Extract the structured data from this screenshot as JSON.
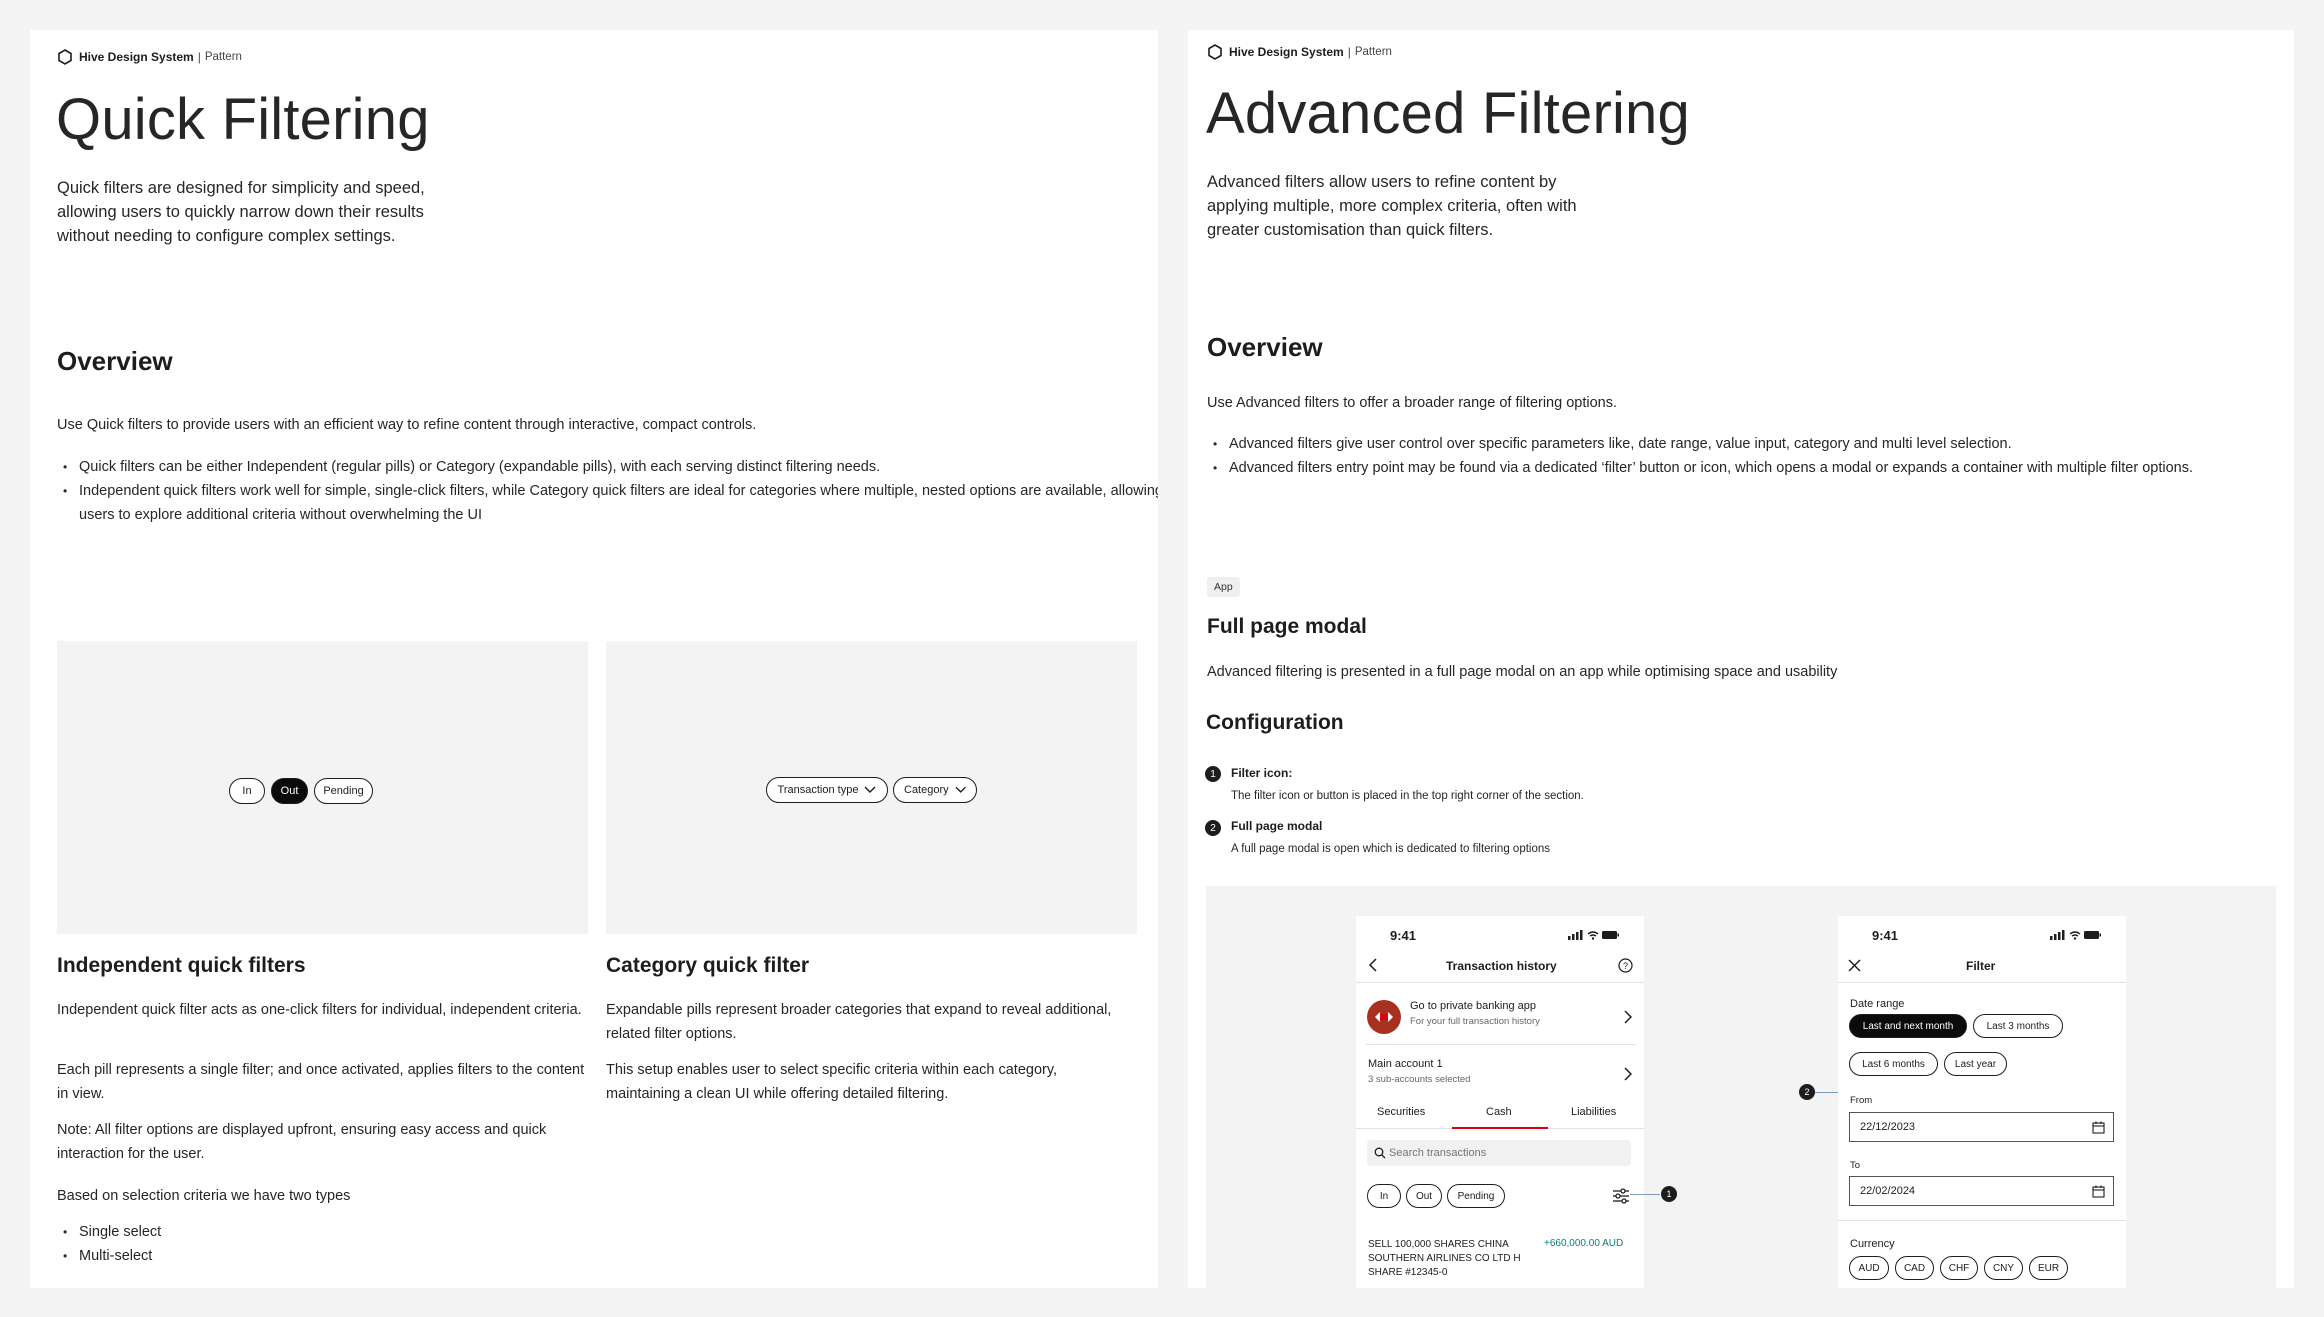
{
  "left": {
    "brand": {
      "name": "Hive Design System",
      "separator": "|",
      "type": "Pattern"
    },
    "title": "Quick Filtering",
    "intro": "Quick filters are designed for simplicity and speed, allowing users to quickly narrow down their results without needing to configure complex settings.",
    "overview_heading": "Overview",
    "overview_text": "Use Quick filters to provide users with an efficient way to refine content through interactive, compact controls.",
    "overview_bullets": [
      "Quick filters can be either Independent (regular pills) or Category (expandable pills), with each serving distinct filtering needs.",
      "Independent quick filters work well for simple, single-click filters, while Category quick filters are ideal for categories where multiple, nested options are available, allowing users to explore additional criteria without overwhelming the UI"
    ],
    "independent_pills": [
      "In",
      "Out",
      "Pending"
    ],
    "category_pills": [
      "Transaction type",
      "Category"
    ],
    "independent": {
      "heading": "Independent quick filters",
      "p1": "Independent quick filter acts as one-click filters for individual, independent criteria.",
      "p2": "Each pill represents a single filter; and once activated, applies filters to the content in view.",
      "p3": "Note: All filter options are displayed upfront, ensuring easy access and quick interaction for the user.",
      "p4": "Based on selection criteria we have two types",
      "types": [
        "Single select",
        "Multi-select"
      ]
    },
    "category": {
      "heading": "Category quick filter",
      "p1": "Expandable pills represent broader categories that expand to reveal additional, related filter options.",
      "p2": "This setup enables user to select specific criteria within each category, maintaining a clean UI while offering detailed filtering."
    }
  },
  "right": {
    "brand": {
      "name": "Hive Design System",
      "separator": "|",
      "type": "Pattern"
    },
    "title": "Advanced Filtering",
    "intro": "Advanced filters allow users to refine content by applying multiple, more complex criteria, often with greater customisation than quick filters.",
    "overview_heading": "Overview",
    "overview_text": "Use Advanced filters to offer a broader range of filtering options.",
    "overview_bullets": [
      "Advanced filters give user control over specific parameters like, date range, value input, category and multi level selection.",
      "Advanced filters entry point may be found via a dedicated ‘filter’ button or icon, which opens a modal or expands a container with multiple filter options."
    ],
    "tag": "App",
    "modal_heading": "Full page modal",
    "modal_text": "Advanced filtering is presented in a full page modal on an app while optimising space and usability",
    "config_heading": "Configuration",
    "steps": [
      {
        "num": "1",
        "title": "Filter icon:",
        "desc": "The filter icon or button is placed in the top right corner of the section."
      },
      {
        "num": "2",
        "title": "Full page modal",
        "desc": "A full page modal is open which is dedicated to filtering options"
      }
    ],
    "phone1": {
      "time": "9:41",
      "title": "Transaction history",
      "private_title": "Go to private banking app",
      "private_sub": "For your full transaction history",
      "account_title": "Main account 1",
      "account_sub": "3 sub-accounts selected",
      "tabs": [
        "Securities",
        "Cash",
        "Liabilities"
      ],
      "search_placeholder": "Search transactions",
      "pills": [
        "In",
        "Out",
        "Pending"
      ],
      "txn_desc": "SELL 100,000 SHARES CHINA SOUTHERN AIRLINES CO LTD H SHARE #12345-0",
      "txn_amount": "+660,000.00 AUD",
      "callout": "1"
    },
    "phone2": {
      "time": "9:41",
      "title": "Filter",
      "date_range_label": "Date range",
      "date_pills": [
        "Last and next month",
        "Last 3 months",
        "Last 6 months",
        "Last year"
      ],
      "from_label": "From",
      "from_value": "22/12/2023",
      "to_label": "To",
      "to_value": "22/02/2024",
      "currency_label": "Currency",
      "currencies": [
        "AUD",
        "CAD",
        "CHF",
        "CNY",
        "EUR"
      ],
      "callout": "2"
    },
    "colors": {
      "accent_red": "#db0011",
      "amount_green": "#00847f",
      "logo_bg": "#a8301f"
    }
  }
}
